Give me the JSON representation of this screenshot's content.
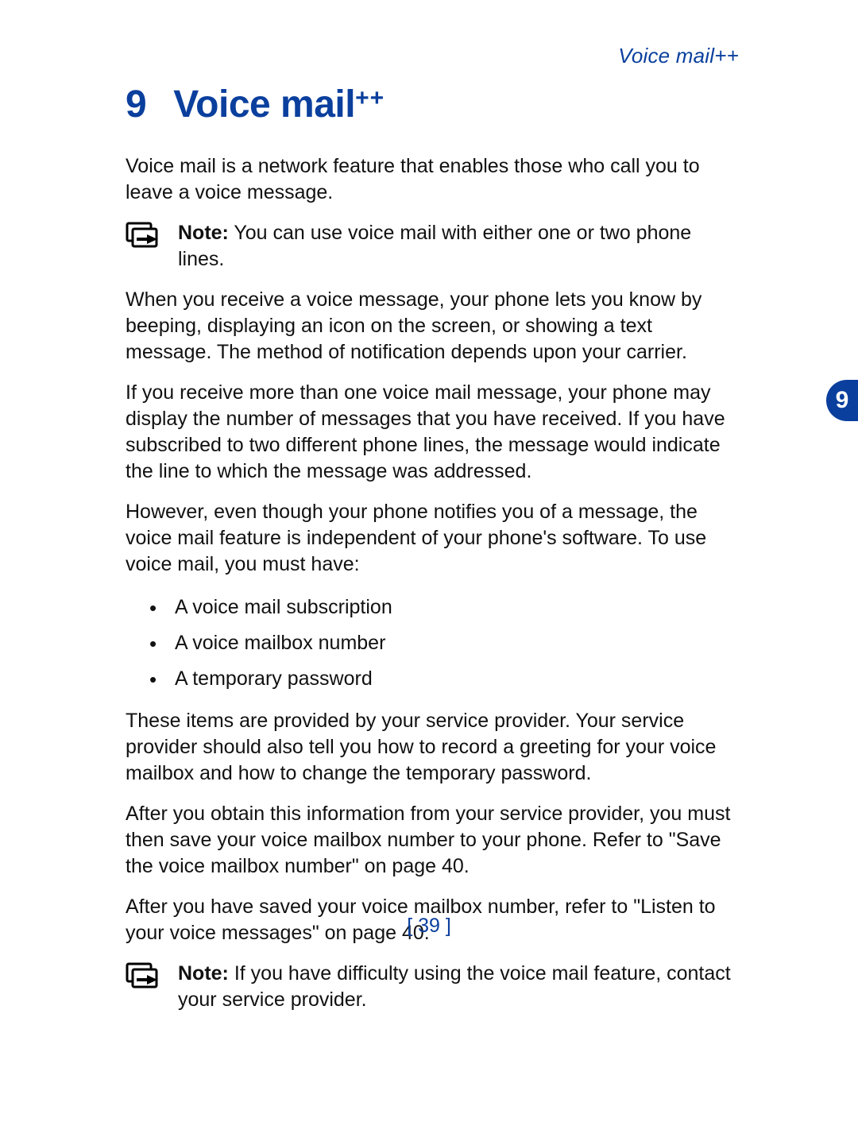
{
  "running_head": "Voice mail++",
  "chapter": {
    "number": "9",
    "title": "Voice mail",
    "suffix": "++"
  },
  "paragraphs": {
    "p1": "Voice mail is a network feature that enables those who call you to leave a voice message.",
    "p2": "When you receive a voice message, your phone lets you know by beeping, displaying an icon on the screen, or showing a text message. The method of notification depends upon your carrier.",
    "p3": "If you receive more than one voice mail message, your phone may display the number of messages that you have received. If you have subscribed to two different phone lines, the message would indicate the line to which the message was addressed.",
    "p4": "However, even though your phone notifies you of a message, the voice mail feature is independent of your phone's software. To use voice mail, you must have:",
    "p5": "These items are provided by your service provider. Your service provider should also tell you how to record a greeting for your voice mailbox and how to change the temporary password.",
    "p6": "After you obtain this information from your service provider, you must then save your voice mailbox number to your phone. Refer to \"Save the voice mailbox number\" on page 40.",
    "p7": "After you have saved your voice mailbox number, refer to \"Listen to your voice messages\" on page 40."
  },
  "notes": {
    "label": "Note:",
    "n1": " You can use voice mail with either one or two phone lines.",
    "n2": " If you have difficulty using the voice mail feature, contact your service provider."
  },
  "bullets": [
    "A voice mail subscription",
    "A voice mailbox number",
    "A temporary password"
  ],
  "tab_number": "9",
  "page_number": "[ 39 ]"
}
